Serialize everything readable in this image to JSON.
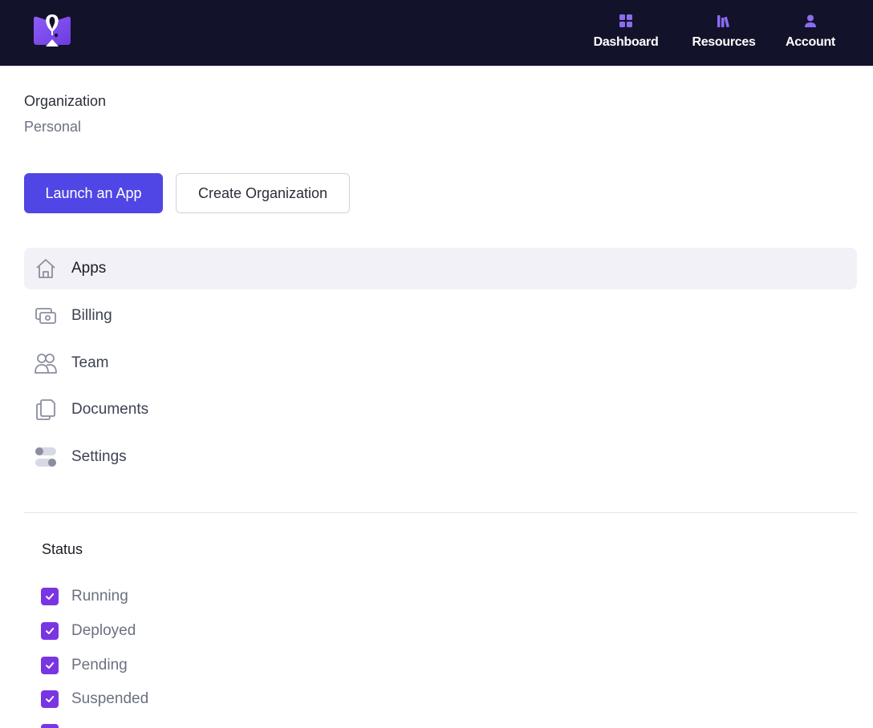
{
  "colors": {
    "topbar_bg": "#12122a",
    "primary": "#5046e5",
    "checkbox": "#7a35e3",
    "nav_icon": "#8b6cf0"
  },
  "nav": {
    "logo_icon": "balloon-logo-icon",
    "items": [
      {
        "label": "Dashboard",
        "icon": "grid-icon"
      },
      {
        "label": "Resources",
        "icon": "books-icon"
      },
      {
        "label": "Account",
        "icon": "user-icon"
      }
    ]
  },
  "org": {
    "label": "Organization",
    "value": "Personal"
  },
  "actions": {
    "launch_label": "Launch an App",
    "create_org_label": "Create Organization"
  },
  "menu": {
    "items": [
      {
        "label": "Apps",
        "icon": "home-icon",
        "active": true
      },
      {
        "label": "Billing",
        "icon": "money-icon",
        "active": false
      },
      {
        "label": "Team",
        "icon": "users-icon",
        "active": false
      },
      {
        "label": "Documents",
        "icon": "documents-icon",
        "active": false
      },
      {
        "label": "Settings",
        "icon": "toggles-icon",
        "active": false
      }
    ]
  },
  "status": {
    "title": "Status",
    "options": [
      {
        "label": "Running",
        "checked": true
      },
      {
        "label": "Deployed",
        "checked": true
      },
      {
        "label": "Pending",
        "checked": true
      },
      {
        "label": "Suspended",
        "checked": true
      }
    ]
  }
}
